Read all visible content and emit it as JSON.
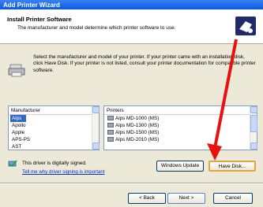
{
  "window": {
    "title": "Add Printer Wizard"
  },
  "header": {
    "title": "Install Printer Software",
    "subtitle": "The manufacturer and model determine which printer software to use."
  },
  "intro": "Select the manufacturer and model of your printer. If your printer came with an installation disk, click Have Disk. If your printer is not listed, consult your printer documentation for compatible printer software.",
  "manufacturer_list": {
    "header": "Manufacturer",
    "items": [
      "Alps",
      "Apollo",
      "Apple",
      "APS-PS",
      "AST"
    ],
    "selected": "Alps"
  },
  "printers_list": {
    "header": "Printers",
    "items": [
      "Alps MD-1000 (MS)",
      "Alps MD-1300 (MS)",
      "Alps MD-1500 (MS)",
      "Alps MD-2010 (MS)"
    ]
  },
  "signed": {
    "text": "This driver is digitally signed.",
    "link": "Tell me why driver signing is important"
  },
  "buttons": {
    "windows_update": "Windows Update",
    "have_disk": "Have Disk...",
    "back": "< Back",
    "next": "Next >",
    "cancel": "Cancel"
  },
  "colors": {
    "annotation_arrow": "#e8110f",
    "titlebar": "#0a5ae0",
    "selection": "#316ac5"
  }
}
